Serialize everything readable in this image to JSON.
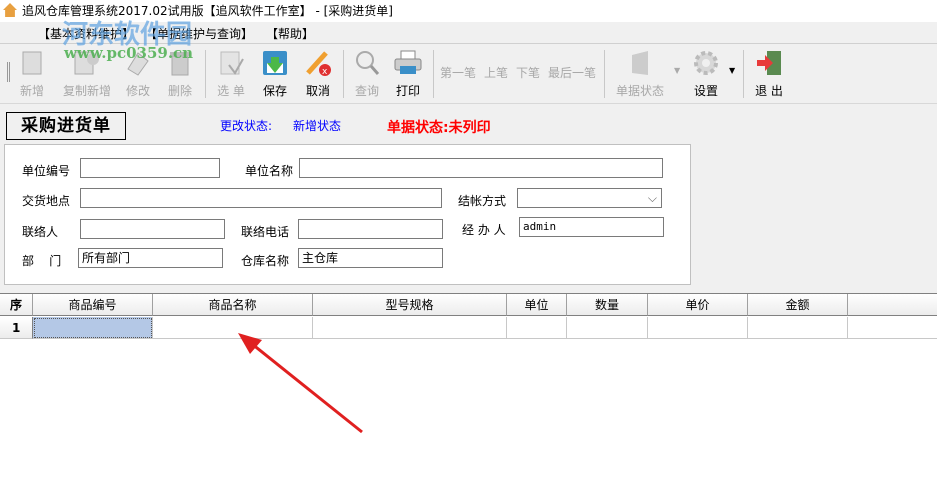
{
  "window": {
    "title": "追风仓库管理系统2017.02试用版【追风软件工作室】 - [采购进货单]"
  },
  "menu": [
    "【基本资料维护】",
    "【单据维护与查询】",
    "【帮助】"
  ],
  "toolbar": {
    "new": "新增",
    "copy_new": "复制新增",
    "edit": "修改",
    "delete": "删除",
    "select": "选 单",
    "save": "保存",
    "cancel": "取消",
    "query": "查询",
    "print": "打印",
    "first": "第一笔",
    "prev": "上笔",
    "next": "下笔",
    "last": "最后一笔",
    "doc_status": "单据状态",
    "settings": "设置",
    "exit": "退 出"
  },
  "form": {
    "title": "采购进货单",
    "change_status_label": "更改状态:",
    "change_status_value": "新增状态",
    "doc_status": "单据状态:未列印",
    "fields": {
      "unit_code": {
        "label": "单位编号",
        "value": ""
      },
      "unit_name": {
        "label": "单位名称",
        "value": ""
      },
      "delivery": {
        "label": "交货地点",
        "value": ""
      },
      "settlement": {
        "label": "结帐方式",
        "value": ""
      },
      "contact": {
        "label": "联络人",
        "value": ""
      },
      "phone": {
        "label": "联络电话",
        "value": ""
      },
      "handler": {
        "label": "经 办 人",
        "value": "admin"
      },
      "dept": {
        "label": "部    门",
        "value": "所有部门"
      },
      "warehouse": {
        "label": "仓库名称",
        "value": "主仓库"
      }
    }
  },
  "grid": {
    "columns": [
      "序",
      "商品编号",
      "商品名称",
      "型号规格",
      "单位",
      "数量",
      "单价",
      "金额",
      ""
    ],
    "rows": [
      [
        "1",
        "",
        "",
        "",
        "",
        "",
        "",
        "",
        ""
      ]
    ]
  },
  "watermark": {
    "name": "河东软件园",
    "url": "www.pc0359.cn"
  },
  "colors": {
    "status_blue": "#0000ff",
    "status_red": "#ff0000",
    "selected_cell": "#b4c8e6",
    "arrow": "#e02020"
  }
}
